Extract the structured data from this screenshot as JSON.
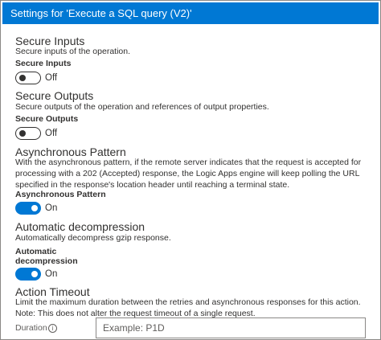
{
  "window": {
    "title": "Settings for 'Execute a SQL query (V2)'"
  },
  "sections": {
    "secure_inputs": {
      "title": "Secure Inputs",
      "description": "Secure inputs of the operation.",
      "label": "Secure Inputs",
      "state": "Off"
    },
    "secure_outputs": {
      "title": "Secure Outputs",
      "description": "Secure outputs of the operation and references of output properties.",
      "label": "Secure Outputs",
      "state": "Off"
    },
    "async_pattern": {
      "title": "Asynchronous Pattern",
      "description": "With the asynchronous pattern, if the remote server indicates that the request is accepted for processing with a 202 (Accepted) response, the Logic Apps engine will keep polling the URL specified in the response's location header until reaching a terminal state.",
      "label": "Asynchronous Pattern",
      "state": "On"
    },
    "auto_decompression": {
      "title": "Automatic decompression",
      "description": "Automatically decompress gzip response.",
      "label_line1": "Automatic",
      "label_line2": "decompression",
      "state": "On"
    },
    "action_timeout": {
      "title": "Action Timeout",
      "description": "Limit the maximum duration between the retries and asynchronous responses for this action. Note: This does not alter the request timeout of a single request.",
      "duration_label": "Duration",
      "duration_value": "",
      "duration_placeholder": "Example: P1D"
    }
  },
  "icons": {
    "info": "info-icon",
    "info_glyph": "i"
  },
  "colors": {
    "accent": "#0078d4",
    "text": "#323130"
  }
}
